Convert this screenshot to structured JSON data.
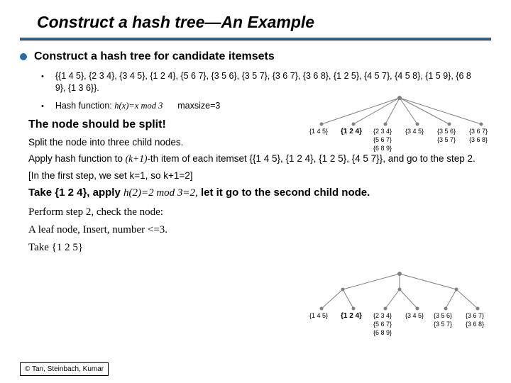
{
  "title": "Construct a hash tree—An Example",
  "l1": "Construct a hash tree for candidate itemsets",
  "l2a": "{{1 4 5}, {2 3 4}, {3 4 5}, {1 2 4}, {5 6 7}, {3 5 6}, {3 5 7}, {3 6 7}, {3 6 8}, {1 2 5}, {4 5 7}, {4 5 8}, {1 5 9}, {6 8 9}, {1 3 6}}.",
  "l2b_prefix": "Hash function: ",
  "l2b_fn": "h(x)=x mod 3",
  "l2b_pad": "      ",
  "l2b_maxsize": "maxsize=3",
  "split_h": "The node should be split!",
  "split_body": "Split the node into three child nodes.",
  "apply_prefix": "Apply hash function to ",
  "apply_k": "(k+1)",
  "apply_suffix": "-th item of each itemset {{1 4 5}, {1 2 4}, {1 2 5}, {4 5 7}}, and go to the step 2.",
  "note": "[In the first step, we set k=1, so k+1=2]",
  "take124_prefix": "Take {1 2 4}, apply ",
  "take124_fn": "h(2)=2 mod 3=2,",
  "take124_suffix": " let it go to the second child node.",
  "perform": "Perform step 2, check the node:",
  "leaf": "A leaf node, Insert, number <=3.",
  "take125": "Take {1 2 5}",
  "footer": "© Tan, Steinbach, Kumar",
  "tree1": {
    "root": "",
    "row1": [
      "{1 4 5}",
      "{1 2 4}",
      "{2 3 4}",
      "{3 4 5}",
      "{3 5 6}",
      "{3 6 7}"
    ],
    "row2a": "",
    "row2b": "{5 6 7}",
    "row2c": "{3 5 7}",
    "row2d": "{3 6 8}",
    "row2e": "{6 8 9}",
    "row2f": ""
  },
  "tree2": {
    "row1": [
      "{1 4 5}",
      "{1 2 4}",
      "{2 3 4}",
      "{3 4 5}",
      "{3 5 6}",
      "{3 6 7}"
    ],
    "row2b": "{5 6 7}",
    "row2c": "{3 5 7}",
    "row2d": "{3 6 8}",
    "row2e": "{6 8 9}"
  }
}
